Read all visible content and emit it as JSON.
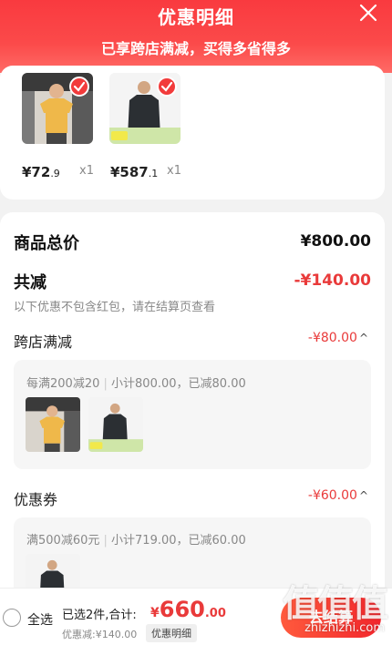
{
  "header": {
    "title": "优惠明细",
    "subtitle": "已享跨店满减，买得多省得多"
  },
  "products": [
    {
      "price_int": "¥72",
      "price_dec": ".9",
      "qty": "x1"
    },
    {
      "price_int": "¥587",
      "price_dec": ".1",
      "qty": "x1"
    }
  ],
  "summary": {
    "total_label": "商品总价",
    "total_value": "¥800.00",
    "discount_label": "共减",
    "discount_value": "-¥140.00",
    "note": "以下优惠不包含红包，请在结算页查看"
  },
  "cross_store": {
    "label": "跨店满减",
    "value": "-¥80.00",
    "chevron": "^",
    "rule": "每满200减20",
    "detail": "小计800.00，已减80.00"
  },
  "coupon": {
    "label": "优惠券",
    "value": "-¥60.00",
    "chevron": "^",
    "rule": "满500减60元",
    "detail": "小计719.00，已减60.00"
  },
  "bottom_bar": {
    "select_all": "全选",
    "selected_info": "已选2件,合计:",
    "total_symbol": "¥",
    "total_int": "660",
    "total_dec": ".00",
    "discount_info": "优惠减:¥140.00",
    "detail_button": "优惠明细",
    "checkout_button": "去结算"
  },
  "watermark": {
    "text": "值值值",
    "site": "zhizhizhi.com"
  },
  "colors": {
    "accent": "#f23b3b",
    "header_bg": "#f93a3f",
    "discount_red": "#e93a3a"
  },
  "icons": [
    "close-icon",
    "check-icon",
    "chevron-up-icon",
    "radio-icon"
  ]
}
